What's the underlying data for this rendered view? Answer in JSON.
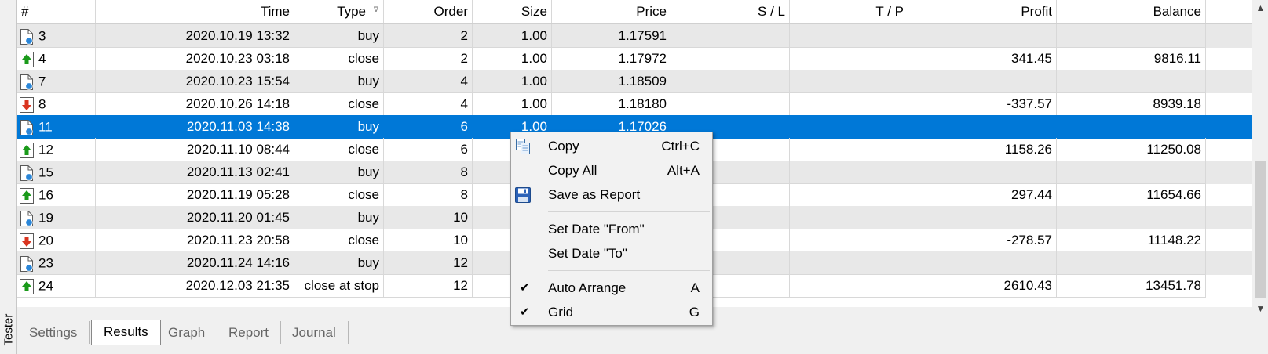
{
  "panel_label": "Tester",
  "columns": {
    "num": "#",
    "time": "Time",
    "type": "Type",
    "order": "Order",
    "size": "Size",
    "price": "Price",
    "sl": "S / L",
    "tp": "T / P",
    "profit": "Profit",
    "balance": "Balance"
  },
  "sort_indicator": "ᐁ",
  "rows": [
    {
      "id": "3",
      "time": "2020.10.19 13:32",
      "type": "buy",
      "order": "2",
      "size": "1.00",
      "price": "1.17591",
      "sl": "",
      "tp": "",
      "profit": "",
      "balance": "",
      "icon": "buy-doc-icon"
    },
    {
      "id": "4",
      "time": "2020.10.23 03:18",
      "type": "close",
      "order": "2",
      "size": "1.00",
      "price": "1.17972",
      "sl": "",
      "tp": "",
      "profit": "341.45",
      "balance": "9816.11",
      "icon": "profit-up-icon"
    },
    {
      "id": "7",
      "time": "2020.10.23 15:54",
      "type": "buy",
      "order": "4",
      "size": "1.00",
      "price": "1.18509",
      "sl": "",
      "tp": "",
      "profit": "",
      "balance": "",
      "icon": "buy-doc-icon"
    },
    {
      "id": "8",
      "time": "2020.10.26 14:18",
      "type": "close",
      "order": "4",
      "size": "1.00",
      "price": "1.18180",
      "sl": "",
      "tp": "",
      "profit": "-337.57",
      "balance": "8939.18",
      "icon": "loss-down-icon"
    },
    {
      "id": "11",
      "time": "2020.11.03 14:38",
      "type": "buy",
      "order": "6",
      "size": "1.00",
      "price": "1.17026",
      "sl": "",
      "tp": "",
      "profit": "",
      "balance": "",
      "icon": "buy-doc-icon"
    },
    {
      "id": "12",
      "time": "2020.11.10 08:44",
      "type": "close",
      "order": "6",
      "size": "",
      "price": "",
      "sl": "",
      "tp": "",
      "profit": "1158.26",
      "balance": "11250.08",
      "icon": "profit-up-icon"
    },
    {
      "id": "15",
      "time": "2020.11.13 02:41",
      "type": "buy",
      "order": "8",
      "size": "",
      "price": "",
      "sl": "",
      "tp": "",
      "profit": "",
      "balance": "",
      "icon": "buy-doc-icon"
    },
    {
      "id": "16",
      "time": "2020.11.19 05:28",
      "type": "close",
      "order": "8",
      "size": "",
      "price": "",
      "sl": "",
      "tp": "",
      "profit": "297.44",
      "balance": "11654.66",
      "icon": "profit-up-icon"
    },
    {
      "id": "19",
      "time": "2020.11.20 01:45",
      "type": "buy",
      "order": "10",
      "size": "",
      "price": "",
      "sl": "",
      "tp": "",
      "profit": "",
      "balance": "",
      "icon": "buy-doc-icon"
    },
    {
      "id": "20",
      "time": "2020.11.23 20:58",
      "type": "close",
      "order": "10",
      "size": "",
      "price": "",
      "sl": "",
      "tp": "",
      "profit": "-278.57",
      "balance": "11148.22",
      "icon": "loss-down-icon"
    },
    {
      "id": "23",
      "time": "2020.11.24 14:16",
      "type": "buy",
      "order": "12",
      "size": "",
      "price": "",
      "sl": "",
      "tp": "",
      "profit": "",
      "balance": "",
      "icon": "buy-doc-icon"
    },
    {
      "id": "24",
      "time": "2020.12.03 21:35",
      "type": "close at stop",
      "order": "12",
      "size": "",
      "price": "",
      "sl": "",
      "tp": "",
      "profit": "2610.43",
      "balance": "13451.78",
      "icon": "profit-up-icon"
    }
  ],
  "selected_row": 4,
  "tabs": [
    "Settings",
    "Results",
    "Graph",
    "Report",
    "Journal"
  ],
  "active_tab": "Results",
  "context_menu": {
    "items": [
      {
        "label": "Copy",
        "shortcut": "Ctrl+C",
        "icon": "copy-icon"
      },
      {
        "label": "Copy All",
        "shortcut": "Alt+A"
      },
      {
        "label": "Save as Report",
        "shortcut": "",
        "icon": "save-icon"
      },
      {
        "separator": true
      },
      {
        "label": "Set Date \"From\"",
        "shortcut": ""
      },
      {
        "label": "Set Date \"To\"",
        "shortcut": ""
      },
      {
        "separator": true
      },
      {
        "label": "Auto Arrange",
        "shortcut": "A",
        "checked": true
      },
      {
        "label": "Grid",
        "shortcut": "G",
        "checked": true
      }
    ]
  },
  "colors": {
    "selection": "#0078d7",
    "alt_row": "#e8e8e8",
    "profit_up": "#1a9a1a",
    "loss_down": "#d9341f",
    "buy_dot": "#2a86d8"
  }
}
